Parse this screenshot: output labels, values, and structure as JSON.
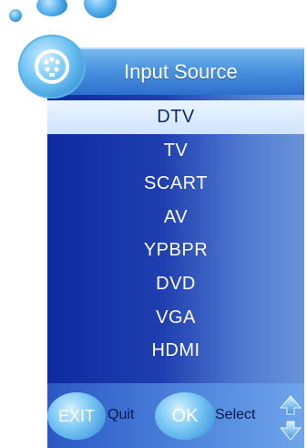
{
  "header": {
    "title": "Input Source"
  },
  "sources": [
    {
      "label": "DTV",
      "selected": true
    },
    {
      "label": "TV",
      "selected": false
    },
    {
      "label": "SCART",
      "selected": false
    },
    {
      "label": "AV",
      "selected": false
    },
    {
      "label": "YPBPR",
      "selected": false
    },
    {
      "label": "DVD",
      "selected": false
    },
    {
      "label": "VGA",
      "selected": false
    },
    {
      "label": "HDMI",
      "selected": false
    }
  ],
  "footer": {
    "exit_key": "EXIT",
    "exit_action": "Quit",
    "ok_key": "OK",
    "ok_action": "Select",
    "nav_icon": "up-down-arrows-icon"
  },
  "colors": {
    "selected_row": "#cfe4ff",
    "list_background": "#1f3fb0",
    "title_bar": "#4b93e0",
    "accent": "#4aa8e8"
  }
}
